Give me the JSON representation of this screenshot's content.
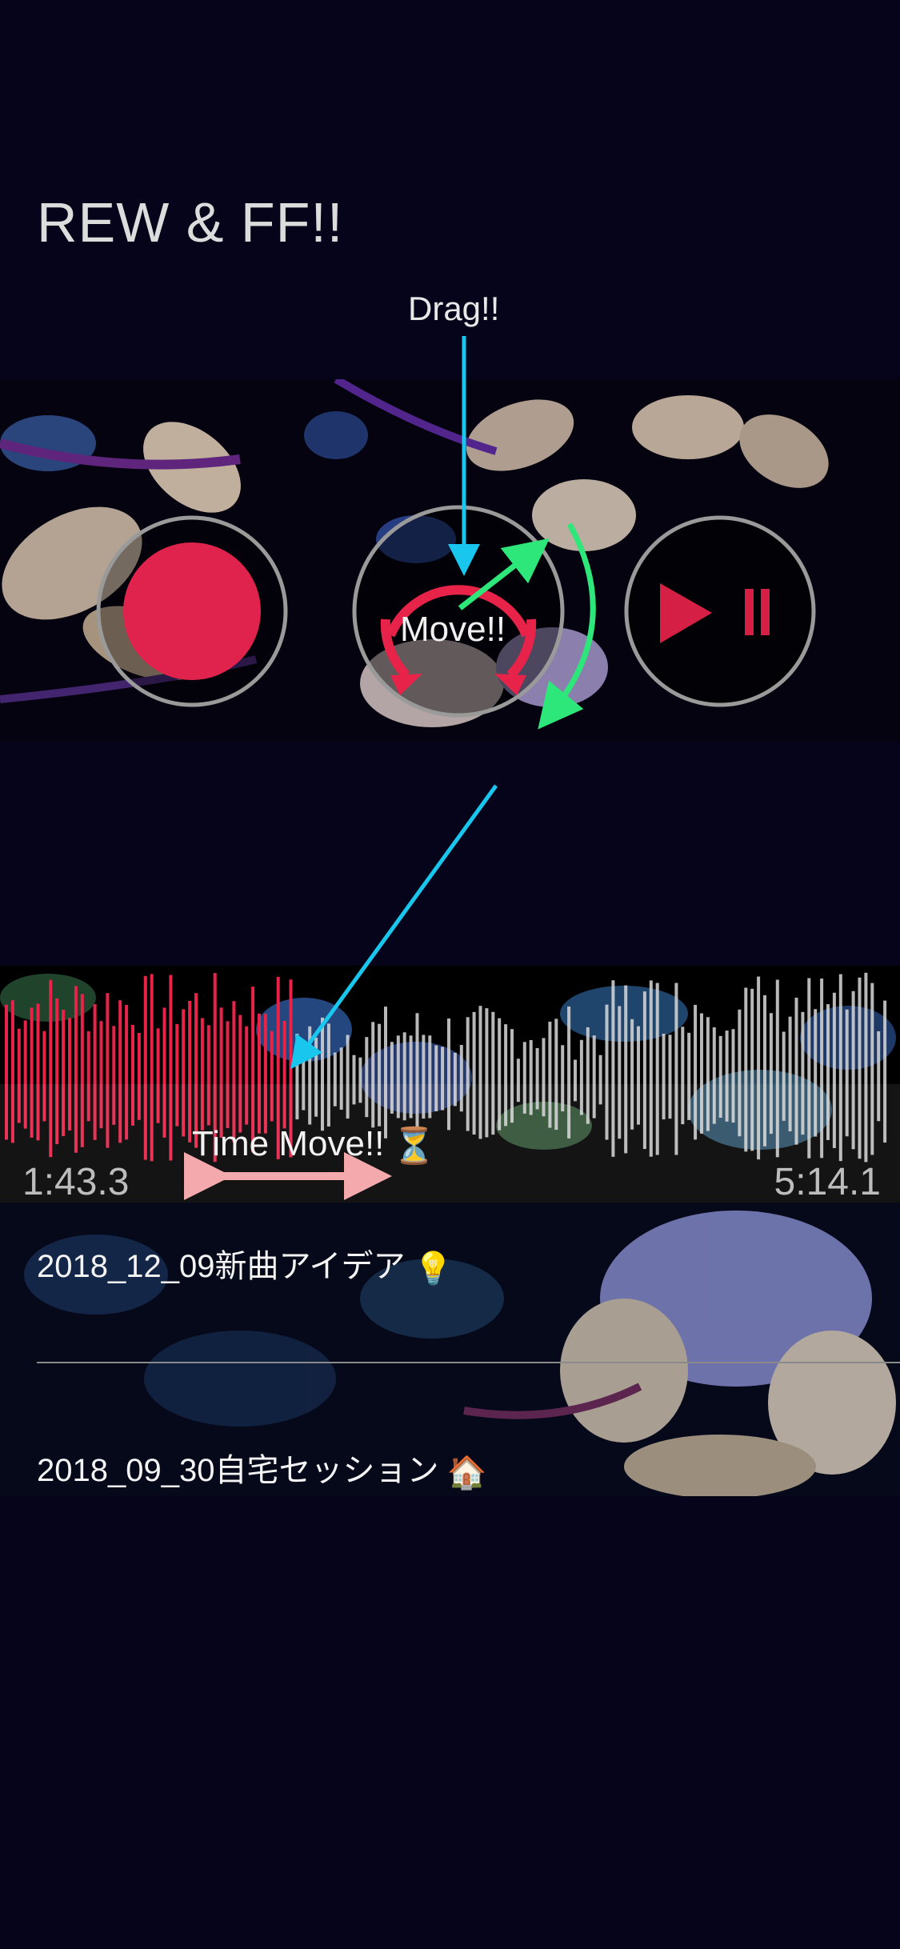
{
  "title": "REW & FF!!",
  "annotations": {
    "drag": "Drag!!",
    "move": "Move!!",
    "time_move": "Time Move!!"
  },
  "player": {
    "record_button": "record",
    "rewind_ff_dial": "rewind-ff",
    "play_pause_button": "play-pause",
    "accent_color": "#e8234a"
  },
  "waveform": {
    "elapsed": "1:43.3",
    "total": "5:14.1",
    "progress_fraction": 0.33
  },
  "recordings": [
    {
      "name": "2018_12_09新曲アイデア",
      "emoji": "lightbulb"
    },
    {
      "name": "2018_09_30自宅セッション",
      "emoji": "house"
    }
  ]
}
